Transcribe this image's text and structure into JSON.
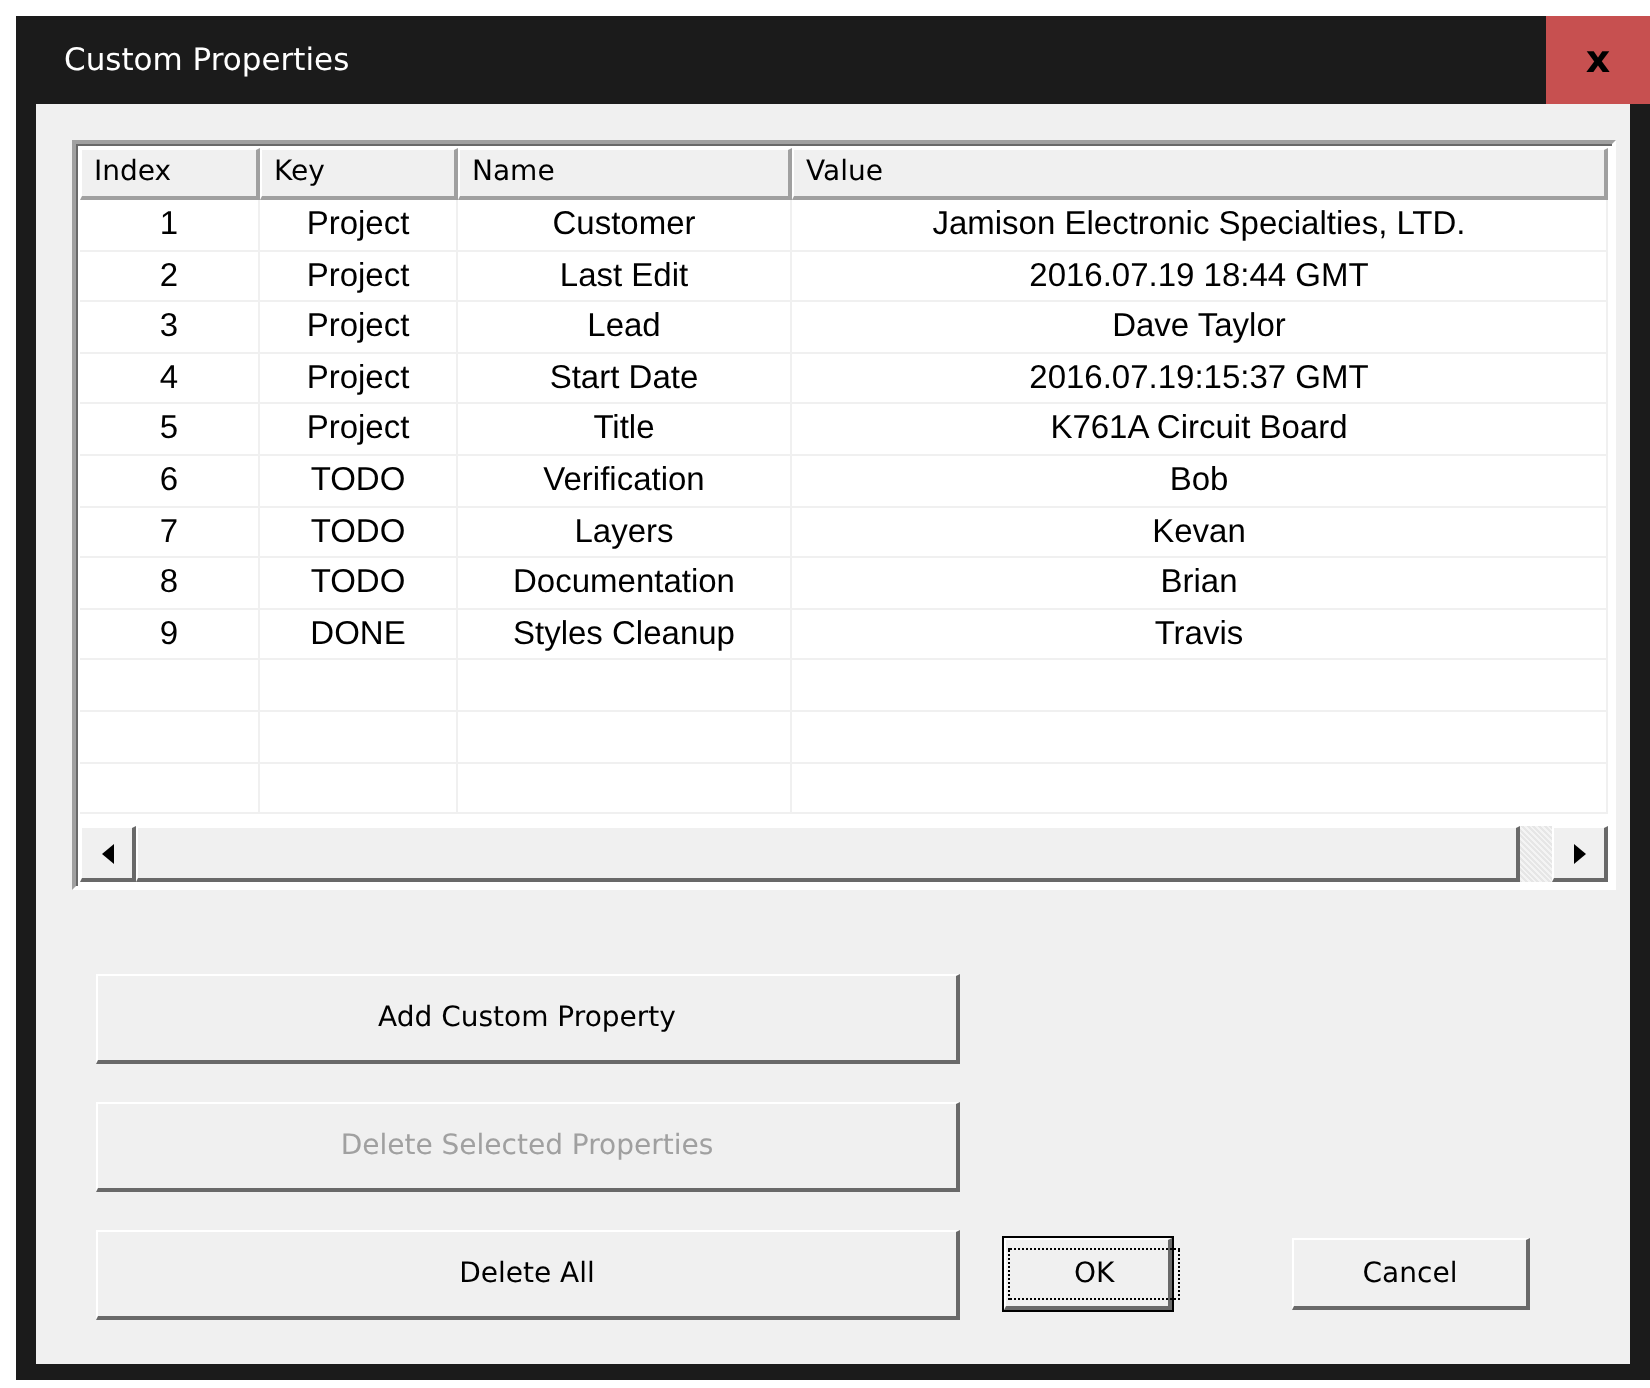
{
  "window": {
    "title": "Custom Properties",
    "close": "x"
  },
  "table": {
    "columns": [
      "Index",
      "Key",
      "Name",
      "Value"
    ],
    "rows": [
      [
        "1",
        "Project",
        "Customer",
        "Jamison Electronic Specialties, LTD."
      ],
      [
        "2",
        "Project",
        "Last Edit",
        "2016.07.19 18:44 GMT"
      ],
      [
        "3",
        "Project",
        "Lead",
        "Dave Taylor"
      ],
      [
        "4",
        "Project",
        "Start Date",
        "2016.07.19:15:37 GMT"
      ],
      [
        "5",
        "Project",
        "Title",
        "K761A Circuit Board"
      ],
      [
        "6",
        "TODO",
        "Verification",
        "Bob"
      ],
      [
        "7",
        "TODO",
        "Layers",
        "Kevan"
      ],
      [
        "8",
        "TODO",
        "Documentation",
        "Brian"
      ],
      [
        "9",
        "DONE",
        "Styles Cleanup",
        "Travis"
      ]
    ]
  },
  "action_buttons": [
    {
      "label": "Add Custom Property",
      "disabled": false
    },
    {
      "label": "Delete Selected Properties",
      "disabled": true
    },
    {
      "label": "Delete All",
      "disabled": false
    }
  ],
  "dialog_buttons": [
    {
      "label": "OK",
      "focused": true
    },
    {
      "label": "Cancel",
      "focused": false
    }
  ]
}
